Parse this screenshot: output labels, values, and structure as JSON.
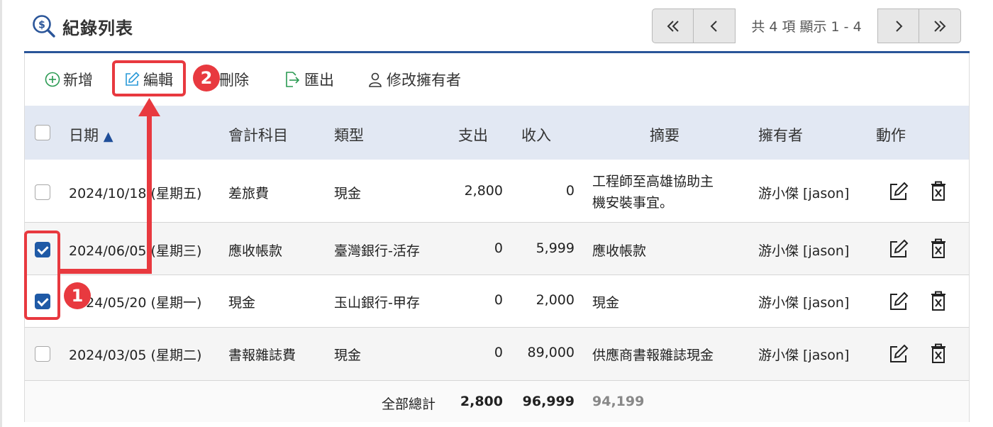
{
  "header": {
    "title": "紀錄列表",
    "pager": {
      "first": "«",
      "prev": "‹",
      "info": "共 4 項 顯示 1 - 4",
      "next": "›",
      "last": "»"
    }
  },
  "toolbar": {
    "add": "新增",
    "edit": "編輯",
    "delete": "刪除",
    "export": "匯出",
    "change_owner": "修改擁有者"
  },
  "table": {
    "columns": {
      "date": "日期",
      "account": "會計科目",
      "type": "類型",
      "expense": "支出",
      "income": "收入",
      "summary": "摘要",
      "owner": "擁有者",
      "action": "動作"
    },
    "sort_indicator": "▲",
    "rows": [
      {
        "checked": false,
        "date": "2024/10/18 (星期五)",
        "account": "差旅費",
        "type": "現金",
        "expense": "2,800",
        "income": "0",
        "summary_line1": "工程師至高雄協助主",
        "summary_line2": "機安裝事宜。",
        "owner": "游小傑 [jason]"
      },
      {
        "checked": true,
        "date": "2024/06/05 (星期三)",
        "account": "應收帳款",
        "type": "臺灣銀行-活存",
        "expense": "0",
        "income": "5,999",
        "summary_line1": "應收帳款",
        "summary_line2": "",
        "owner": "游小傑 [jason]"
      },
      {
        "checked": true,
        "date": "2024/05/20 (星期一)",
        "account": "現金",
        "type": "玉山銀行-甲存",
        "expense": "0",
        "income": "2,000",
        "summary_line1": "現金",
        "summary_line2": "",
        "owner": "游小傑 [jason]"
      },
      {
        "checked": false,
        "date": "2024/03/05 (星期二)",
        "account": "書報雜誌費",
        "type": "現金",
        "expense": "0",
        "income": "89,000",
        "summary_line1": "供應商書報雜誌現金",
        "summary_line2": "",
        "owner": "游小傑 [jason]"
      }
    ],
    "totals": {
      "label": "全部總計",
      "expense": "2,800",
      "income": "96,999",
      "balance": "94,199"
    }
  },
  "annotations": {
    "step1": "1",
    "step2": "2"
  },
  "colors": {
    "accent": "#2a5599",
    "checkbox": "#1f5aa6",
    "annotation": "#e8393f",
    "header_bg": "#e2e8f3"
  }
}
